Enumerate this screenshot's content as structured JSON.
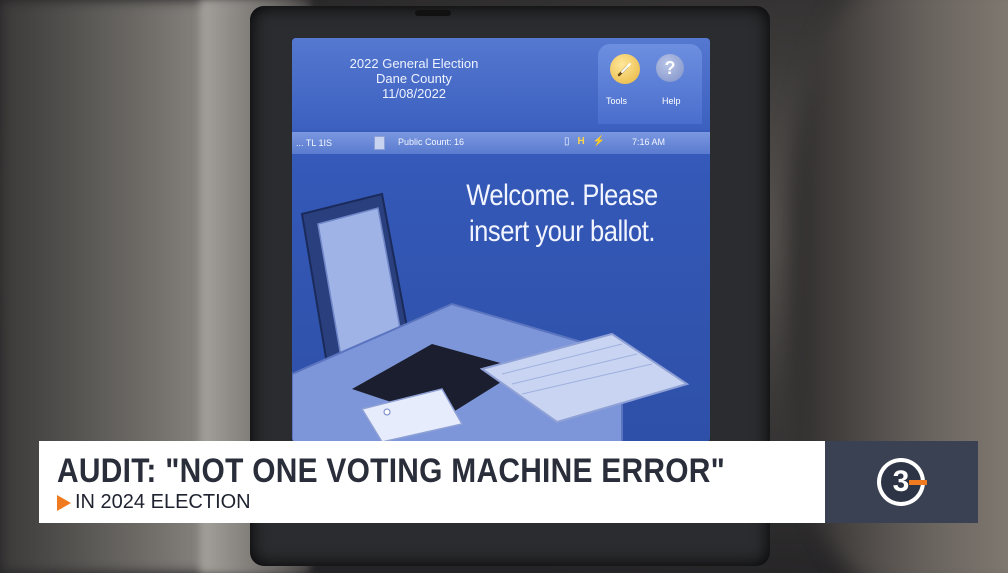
{
  "screen": {
    "election_line1": "2022 General Election",
    "election_line2": "Dane County",
    "election_line3": "11/08/2022",
    "tools_label": "Tools",
    "help_label": "Help",
    "help_glyph": "?",
    "status_left": "... TL 1IS",
    "public_count": "Public Count: 16",
    "time": "7:16 AM",
    "welcome_line1": "Welcome. Please",
    "welcome_line2": "insert your ballot."
  },
  "banner": {
    "headline": "AUDIT: \"NOT ONE VOTING MACHINE ERROR\"",
    "subhead": "IN 2024 ELECTION",
    "accent_color": "#f07a1f",
    "logo_text": "3"
  },
  "colors": {
    "screen_blue": "#3458b7",
    "banner_bg": "#ffffff",
    "logo_bg": "#3a4152"
  }
}
